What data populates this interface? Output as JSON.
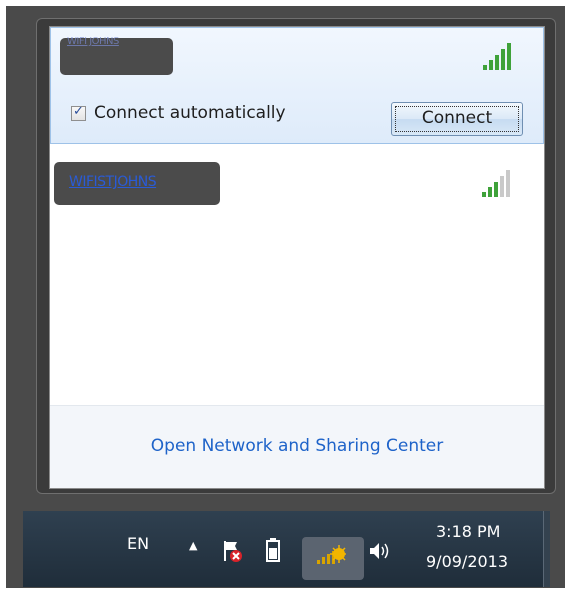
{
  "networks": [
    {
      "ssid": "WIFI JOHNS",
      "connect_automatically_label": "Connect automatically",
      "connect_automatically_checked": true,
      "connect_button": "Connect",
      "signal_icon": "wifi-signal-5-bars",
      "signal_color": "#3fa23a"
    },
    {
      "ssid": "WIFISTJOHNS",
      "signal_icon": "wifi-signal-3-bars",
      "signal_color": "#3fa23a"
    }
  ],
  "footer": {
    "link_label": "Open Network and Sharing Center"
  },
  "taskbar": {
    "language": "EN",
    "time": "3:18 PM",
    "date": "9/09/2013",
    "icons": [
      "show-hidden-icons-arrow-icon",
      "action-center-flag-icon",
      "battery-icon",
      "network-icon",
      "volume-icon"
    ]
  }
}
